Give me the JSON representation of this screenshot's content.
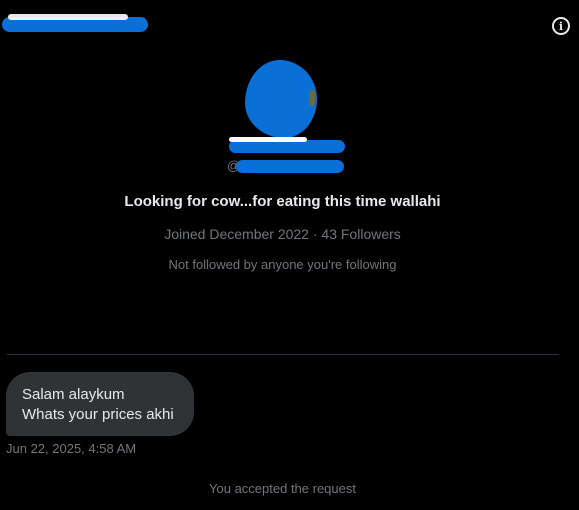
{
  "header": {
    "name": "",
    "info_icon": "info-icon"
  },
  "profile": {
    "avatar": "avatar",
    "display_name": "",
    "handle_prefix": "@",
    "bio": "Looking for cow...for eating this time wallahi",
    "joined": "Joined December 2022",
    "separator": "·",
    "followers": "43 Followers",
    "follow_note": "Not followed by anyone you're following"
  },
  "messages": [
    {
      "lines": [
        "Salam alaykum",
        "Whats your prices akhi"
      ],
      "timestamp": "Jun 22, 2025, 4:58 AM"
    }
  ],
  "status": "You accepted the request",
  "colors": {
    "redaction": "#0a6fd6",
    "background": "#000000",
    "bubble": "#2f3336",
    "muted": "#71767b"
  }
}
